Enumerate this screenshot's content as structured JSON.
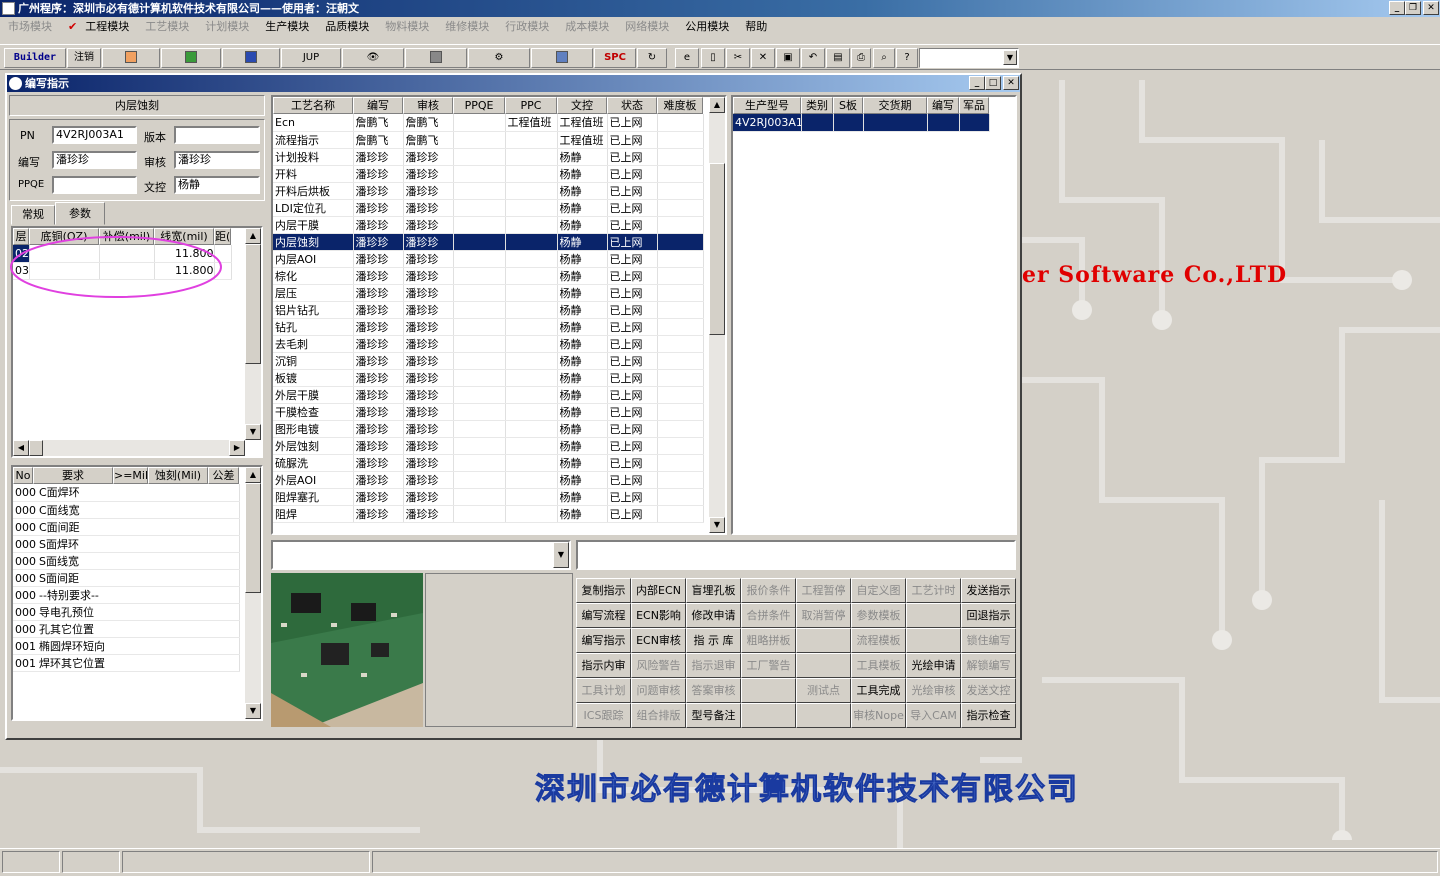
{
  "app_title": "广州程序：深圳市必有德计算机软件技术有限公司——使用者：汪朝文",
  "window_buttons": [
    "_",
    "❐",
    "✕"
  ],
  "menu": [
    {
      "label": "市场模块",
      "enabled": false
    },
    {
      "label": "工程模块",
      "enabled": true,
      "checked": true
    },
    {
      "label": "工艺模块",
      "enabled": false
    },
    {
      "label": "计划模块",
      "enabled": false
    },
    {
      "label": "生产模块",
      "enabled": true
    },
    {
      "label": "品质模块",
      "enabled": true
    },
    {
      "label": "物料模块",
      "enabled": false
    },
    {
      "label": "维修模块",
      "enabled": false
    },
    {
      "label": "行政模块",
      "enabled": false
    },
    {
      "label": "成本模块",
      "enabled": false
    },
    {
      "label": "网络模块",
      "enabled": false
    },
    {
      "label": "公用模块",
      "enabled": true
    },
    {
      "label": "帮助",
      "enabled": true
    }
  ],
  "toolbar": {
    "builder": "Builder",
    "logout": "注销",
    "jup": "JUP",
    "spc": "SPC"
  },
  "child": {
    "title": "编写指示",
    "left": {
      "process_title": "内层蚀刻",
      "pn_label": "PN",
      "pn_value": "4V2RJ003A1",
      "version_label": "版本",
      "version_value": "",
      "writer_label": "编写",
      "writer_value": "潘珍珍",
      "reviewer_label": "审核",
      "reviewer_value": "潘珍珍",
      "ppqe_label": "PPQE",
      "ppqe_value": "",
      "doc_label": "文控",
      "doc_value": "杨静",
      "tab_general": "常规",
      "tab_params": "参数",
      "layer_headers": [
        "层",
        "底铜(OZ)",
        "补偿(mil)",
        "线宽(mil)",
        "距(mi"
      ],
      "layer_rows": [
        [
          "02",
          "",
          "",
          "11.800",
          ""
        ],
        [
          "03",
          "",
          "",
          "11.800",
          ""
        ]
      ],
      "req_headers": [
        "No",
        "要求",
        ">=Mil",
        "蚀刻(Mil)",
        "公差"
      ],
      "req_rows": [
        [
          "000",
          "C面焊环"
        ],
        [
          "000",
          "C面线宽"
        ],
        [
          "000",
          "C面间距"
        ],
        [
          "000",
          "S面焊环"
        ],
        [
          "000",
          "S面线宽"
        ],
        [
          "000",
          "S面间距"
        ],
        [
          "000",
          "--特别要求--"
        ],
        [
          "000",
          "导电孔预位"
        ],
        [
          "000",
          "孔其它位置"
        ],
        [
          "001",
          "椭圆焊环短向"
        ],
        [
          "001",
          "焊环其它位置"
        ]
      ]
    },
    "process_headers": [
      "工艺名称",
      "编写",
      "审核",
      "PPQE",
      "PPC",
      "文控",
      "状态",
      "难度板"
    ],
    "process_rows": [
      [
        "Ecn",
        "詹鹏飞",
        "詹鹏飞",
        "",
        "工程值班",
        "工程值班",
        "已上网",
        ""
      ],
      [
        "流程指示",
        "詹鹏飞",
        "詹鹏飞",
        "",
        "",
        "工程值班",
        "已上网",
        ""
      ],
      [
        "计划投料",
        "潘珍珍",
        "潘珍珍",
        "",
        "",
        "杨静",
        "已上网",
        ""
      ],
      [
        "开料",
        "潘珍珍",
        "潘珍珍",
        "",
        "",
        "杨静",
        "已上网",
        ""
      ],
      [
        "开料后烘板",
        "潘珍珍",
        "潘珍珍",
        "",
        "",
        "杨静",
        "已上网",
        ""
      ],
      [
        "LDI定位孔",
        "潘珍珍",
        "潘珍珍",
        "",
        "",
        "杨静",
        "已上网",
        ""
      ],
      [
        "内层干膜",
        "潘珍珍",
        "潘珍珍",
        "",
        "",
        "杨静",
        "已上网",
        ""
      ],
      [
        "内层蚀刻",
        "潘珍珍",
        "潘珍珍",
        "",
        "",
        "杨静",
        "已上网",
        ""
      ],
      [
        "内层AOI",
        "潘珍珍",
        "潘珍珍",
        "",
        "",
        "杨静",
        "已上网",
        ""
      ],
      [
        "棕化",
        "潘珍珍",
        "潘珍珍",
        "",
        "",
        "杨静",
        "已上网",
        ""
      ],
      [
        "层压",
        "潘珍珍",
        "潘珍珍",
        "",
        "",
        "杨静",
        "已上网",
        ""
      ],
      [
        "铝片钻孔",
        "潘珍珍",
        "潘珍珍",
        "",
        "",
        "杨静",
        "已上网",
        ""
      ],
      [
        "钻孔",
        "潘珍珍",
        "潘珍珍",
        "",
        "",
        "杨静",
        "已上网",
        ""
      ],
      [
        "去毛刺",
        "潘珍珍",
        "潘珍珍",
        "",
        "",
        "杨静",
        "已上网",
        ""
      ],
      [
        "沉铜",
        "潘珍珍",
        "潘珍珍",
        "",
        "",
        "杨静",
        "已上网",
        ""
      ],
      [
        "板镀",
        "潘珍珍",
        "潘珍珍",
        "",
        "",
        "杨静",
        "已上网",
        ""
      ],
      [
        "外层干膜",
        "潘珍珍",
        "潘珍珍",
        "",
        "",
        "杨静",
        "已上网",
        ""
      ],
      [
        "干膜检查",
        "潘珍珍",
        "潘珍珍",
        "",
        "",
        "杨静",
        "已上网",
        ""
      ],
      [
        "图形电镀",
        "潘珍珍",
        "潘珍珍",
        "",
        "",
        "杨静",
        "已上网",
        ""
      ],
      [
        "外层蚀刻",
        "潘珍珍",
        "潘珍珍",
        "",
        "",
        "杨静",
        "已上网",
        ""
      ],
      [
        "硫脲洗",
        "潘珍珍",
        "潘珍珍",
        "",
        "",
        "杨静",
        "已上网",
        ""
      ],
      [
        "外层AOI",
        "潘珍珍",
        "潘珍珍",
        "",
        "",
        "杨静",
        "已上网",
        ""
      ],
      [
        "阻焊塞孔",
        "潘珍珍",
        "潘珍珍",
        "",
        "",
        "杨静",
        "已上网",
        ""
      ],
      [
        "阻焊",
        "潘珍珍",
        "潘珍珍",
        "",
        "",
        "杨静",
        "已上网",
        ""
      ]
    ],
    "selected_process_index": 7,
    "product_headers": [
      "生产型号",
      "类别",
      "S板",
      "交货期",
      "编写",
      "军品"
    ],
    "product_rows": [
      [
        "4V2RJ003A1",
        "",
        "",
        "",
        "",
        ""
      ]
    ],
    "buttons": [
      [
        {
          "l": "复制指示",
          "e": true
        },
        {
          "l": "内部ECN",
          "e": true
        },
        {
          "l": "盲埋孔板",
          "e": true
        },
        {
          "l": "报价条件",
          "e": false
        },
        {
          "l": "工程暂停",
          "e": false
        },
        {
          "l": "自定义图",
          "e": false
        },
        {
          "l": "工艺计时",
          "e": false
        },
        {
          "l": "发送指示",
          "e": true
        }
      ],
      [
        {
          "l": "编写流程",
          "e": true
        },
        {
          "l": "ECN影响",
          "e": true
        },
        {
          "l": "修改申请",
          "e": true
        },
        {
          "l": "合拼条件",
          "e": false
        },
        {
          "l": "取消暂停",
          "e": false
        },
        {
          "l": "参数模板",
          "e": false
        },
        {
          "l": "",
          "e": false
        },
        {
          "l": "回退指示",
          "e": true
        }
      ],
      [
        {
          "l": "编写指示",
          "e": true
        },
        {
          "l": "ECN审核",
          "e": true
        },
        {
          "l": "指 示 库",
          "e": true
        },
        {
          "l": "粗略拼板",
          "e": false
        },
        {
          "l": "",
          "e": false
        },
        {
          "l": "流程模板",
          "e": false
        },
        {
          "l": "",
          "e": false
        },
        {
          "l": "锁住编写",
          "e": false
        }
      ],
      [
        {
          "l": "指示内审",
          "e": true
        },
        {
          "l": "风险警告",
          "e": false
        },
        {
          "l": "指示退审",
          "e": false
        },
        {
          "l": "工厂警告",
          "e": false
        },
        {
          "l": "",
          "e": false
        },
        {
          "l": "工具模板",
          "e": false
        },
        {
          "l": "光绘申请",
          "e": true
        },
        {
          "l": "解锁编写",
          "e": false
        }
      ],
      [
        {
          "l": "工具计划",
          "e": false
        },
        {
          "l": "问题审核",
          "e": false
        },
        {
          "l": "答案审核",
          "e": false
        },
        {
          "l": "",
          "e": false
        },
        {
          "l": "测试点",
          "e": false
        },
        {
          "l": "工具完成",
          "e": true
        },
        {
          "l": "光绘审核",
          "e": false
        },
        {
          "l": "发送文控",
          "e": false
        }
      ],
      [
        {
          "l": "ICS跟踪",
          "e": false
        },
        {
          "l": "组合排版",
          "e": false
        },
        {
          "l": "型号备注",
          "e": true
        },
        {
          "l": "",
          "e": false
        },
        {
          "l": "",
          "e": false
        },
        {
          "l": "审核Nope",
          "e": false
        },
        {
          "l": "导入CAM",
          "e": false
        },
        {
          "l": "指示检查",
          "e": true
        }
      ]
    ]
  },
  "background": {
    "english_text": "er Software Co.,LTD",
    "chinese_text": "深圳市必有德计算机软件技术有限公司",
    "accent_color": "#e00000",
    "brand_blue": "#6a8fe0"
  }
}
